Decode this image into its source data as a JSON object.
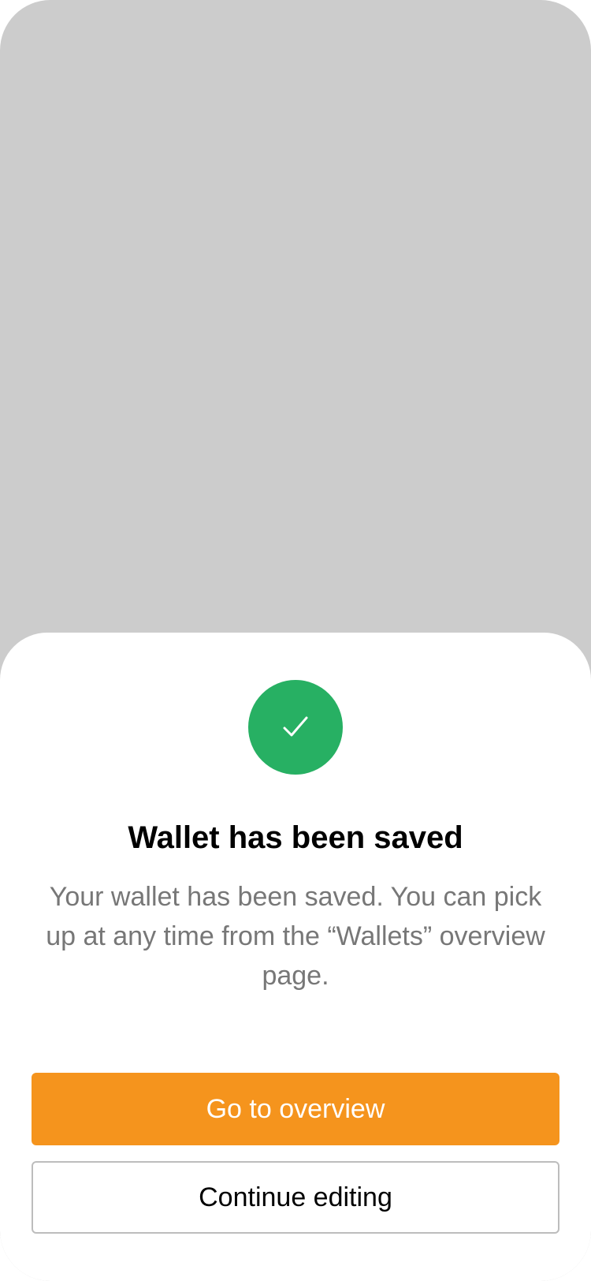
{
  "dialog": {
    "icon": "checkmark-icon",
    "title": "Wallet has been saved",
    "message": "Your wallet has been saved. You can pick up at any time from the “Wallets” overview page.",
    "primary_button": "Go to overview",
    "secondary_button": "Continue editing"
  },
  "colors": {
    "backdrop": "#cccccc",
    "success": "#27b063",
    "accent": "#f5941d",
    "body_text": "#777777",
    "title_text": "#000000"
  }
}
